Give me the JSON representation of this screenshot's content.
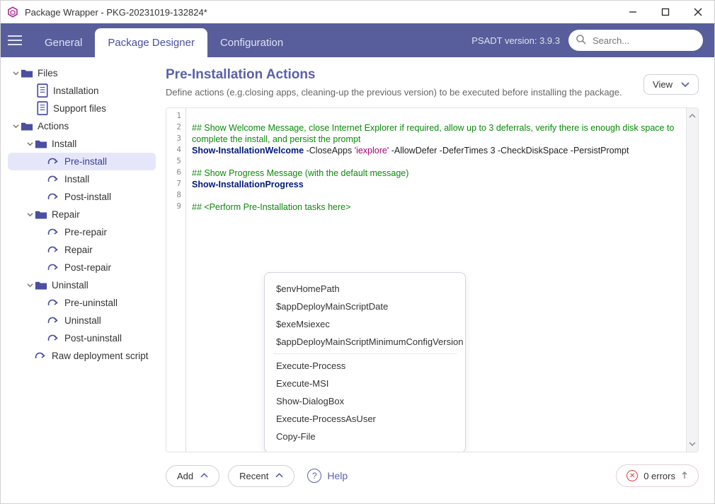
{
  "title": "Package Wrapper - PKG-20231019-132824*",
  "tabs": [
    "General",
    "Package Designer",
    "Configuration"
  ],
  "active_tab_index": 1,
  "psadt_version": "PSADT version: 3.9.3",
  "search_placeholder": "Search...",
  "sidebar": {
    "files": {
      "label": "Files",
      "children": [
        "Installation",
        "Support files"
      ]
    },
    "actions": {
      "label": "Actions",
      "install": {
        "label": "Install",
        "children": [
          "Pre-install",
          "Install",
          "Post-install"
        ]
      },
      "repair": {
        "label": "Repair",
        "children": [
          "Pre-repair",
          "Repair",
          "Post-repair"
        ]
      },
      "uninstall": {
        "label": "Uninstall",
        "children": [
          "Pre-uninstall",
          "Uninstall",
          "Post-uninstall"
        ]
      },
      "raw": "Raw deployment script"
    },
    "selected": "Pre-install"
  },
  "main": {
    "title": "Pre-Installation Actions",
    "subtitle": "Define actions (e.g.closing apps, cleaning-up the previous version) to be executed before installing the package.",
    "view_button": "View"
  },
  "editor": {
    "line_numbers": [
      "1",
      "2",
      "3",
      "4",
      "5",
      "6",
      "7",
      "8",
      "9"
    ],
    "lines": [
      {
        "type": "blank"
      },
      {
        "type": "comment",
        "text": "## Show Welcome Message, close Internet Explorer if required, allow up to 3 deferrals, verify there is enough disk space to complete the install, and persist the prompt"
      },
      {
        "type": "cmd",
        "kw": "Show-InstallationWelcome",
        "rest": [
          " -CloseApps ",
          "'iexplore'",
          " -AllowDefer -DeferTimes ",
          "3",
          " -CheckDiskSpace -PersistPrompt"
        ]
      },
      {
        "type": "blank"
      },
      {
        "type": "comment",
        "text": "## Show Progress Message (with the default message)"
      },
      {
        "type": "cmd",
        "kw": "Show-InstallationProgress",
        "rest": []
      },
      {
        "type": "blank"
      },
      {
        "type": "comment",
        "text": "## <Perform Pre-Installation tasks here>"
      },
      {
        "type": "blank"
      }
    ]
  },
  "suggestions": {
    "vars": [
      "$envHomePath",
      "$appDeployMainScriptDate",
      "$exeMsiexec",
      "$appDeployMainScriptMinimumConfigVersion"
    ],
    "cmds": [
      "Execute-Process",
      "Execute-MSI",
      "Show-DialogBox",
      "Execute-ProcessAsUser",
      "Copy-File"
    ]
  },
  "bottom": {
    "add": "Add",
    "recent": "Recent",
    "help": "Help",
    "errors": "0 errors"
  }
}
